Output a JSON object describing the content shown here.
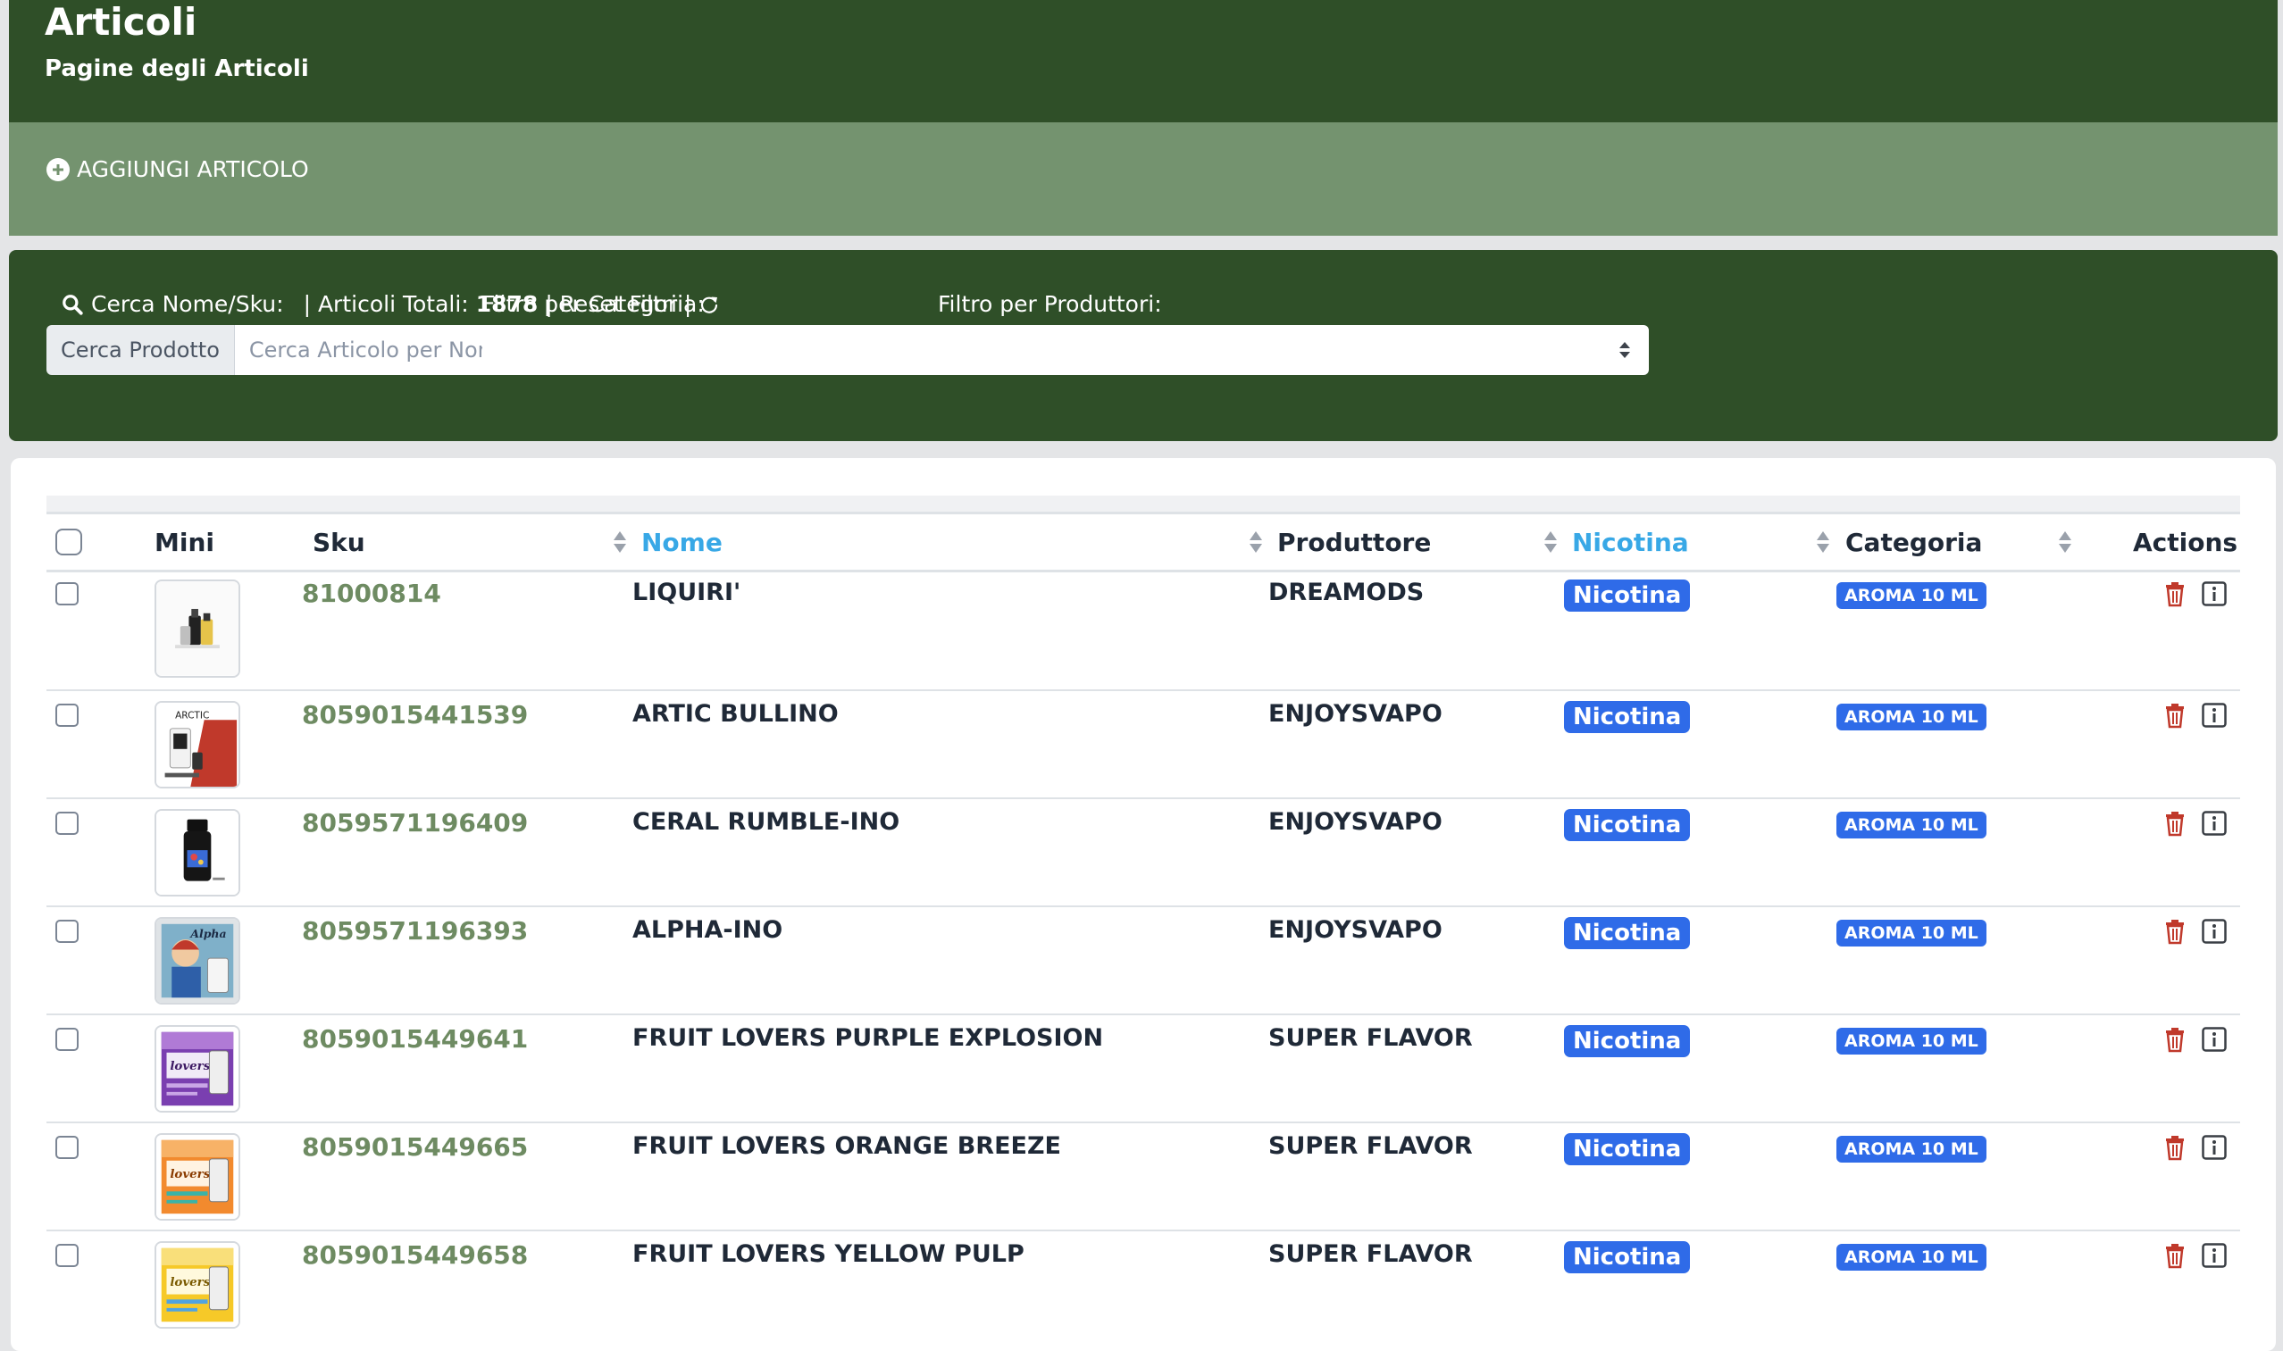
{
  "header": {
    "title": "Articoli",
    "subtitle": "Pagine degli Articoli"
  },
  "actions": {
    "add_label": "AGGIUNGI ARTICOLO",
    "add_icon": "plus-circle-icon"
  },
  "filters": {
    "search_label": "Cerca Nome/Sku:",
    "totals_prefix": "| Articoli Totali:",
    "totals_count": "1878",
    "reset_label": "| Reset Filtri |",
    "search_addon": "Cerca Prodotto",
    "search_placeholder": "Cerca Articolo per Nome/Sku",
    "search_value": "",
    "category_label": "Filtro per Categoria:",
    "category_value": "",
    "producer_label": "Filtro per Produttori:",
    "producer_value": ""
  },
  "table": {
    "columns": {
      "mini": "Mini",
      "sku": "Sku",
      "name": "Nome",
      "producer": "Produttore",
      "nicotine": "Nicotina",
      "category": "Categoria",
      "actions": "Actions"
    },
    "rows": [
      {
        "sku": "81000814",
        "name": "LIQUIRI'",
        "producer": "DREAMODS",
        "nicotine": "Nicotina",
        "category": "AROMA 10 ML",
        "thumb": "bottles"
      },
      {
        "sku": "8059015441539",
        "name": "ARTIC BULLINO",
        "producer": "ENJOYSVAPO",
        "nicotine": "Nicotina",
        "category": "AROMA 10 ML",
        "thumb": "artic"
      },
      {
        "sku": "8059571196409",
        "name": "CERAL RUMBLE-INO",
        "producer": "ENJOYSVAPO",
        "nicotine": "Nicotina",
        "category": "AROMA 10 ML",
        "thumb": "dark-bottle"
      },
      {
        "sku": "8059571196393",
        "name": "ALPHA-INO",
        "producer": "ENJOYSVAPO",
        "nicotine": "Nicotina",
        "category": "AROMA 10 ML",
        "thumb": "alpha"
      },
      {
        "sku": "8059015449641",
        "name": "FRUIT LOVERS PURPLE EXPLOSION",
        "producer": "SUPER FLAVOR",
        "nicotine": "Nicotina",
        "category": "AROMA 10 ML",
        "thumb": "purple"
      },
      {
        "sku": "8059015449665",
        "name": "FRUIT LOVERS ORANGE BREEZE",
        "producer": "SUPER FLAVOR",
        "nicotine": "Nicotina",
        "category": "AROMA 10 ML",
        "thumb": "orange"
      },
      {
        "sku": "8059015449658",
        "name": "FRUIT LOVERS YELLOW PULP",
        "producer": "SUPER FLAVOR",
        "nicotine": "Nicotina",
        "category": "AROMA 10 ML",
        "thumb": "yellow"
      }
    ]
  },
  "colors": {
    "header_bg": "#2f4f28",
    "actionbar_bg": "#74936f",
    "badge_blue": "#2f6be8",
    "sku_green": "#6e8b62",
    "sorted_header": "#38a8e6",
    "trash_red": "#c0392b"
  },
  "icons": [
    "search-icon",
    "refresh-icon",
    "sort-icon",
    "trash-icon",
    "info-icon",
    "select-arrows-icon"
  ]
}
